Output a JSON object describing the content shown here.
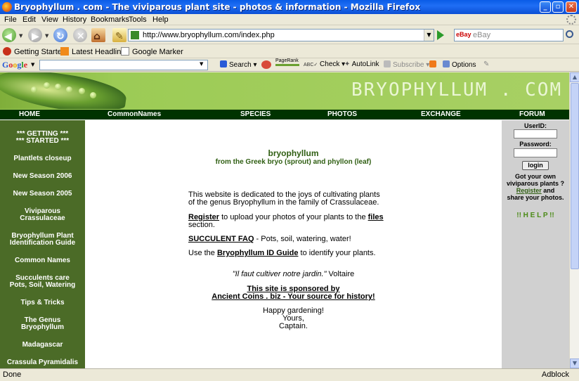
{
  "window": {
    "title": "Bryophyllum . com - The viviparous plant site - photos & information - Mozilla Firefox"
  },
  "menu": [
    "File",
    "Edit",
    "View",
    "History",
    "Bookmarks",
    "Tools",
    "Help"
  ],
  "navbar": {
    "url": "http://www.bryophyllum.com/index.php",
    "search_placeholder": "eBay",
    "search_engine_label": "eBay"
  },
  "bookmarks": [
    "Getting Started",
    "Latest Headlines",
    "Google Marker"
  ],
  "google_toolbar": {
    "logo": "Google",
    "items": {
      "search": "Search",
      "pagerank": "PageRank",
      "check": "Check",
      "autolink": "AutoLink",
      "subscribe": "Subscribe",
      "options": "Options"
    }
  },
  "site": {
    "brand": "BRYOPHYLLUM . COM",
    "topnav": [
      "HOME",
      "CommonNames",
      "SPECIES",
      "PHOTOS",
      "EXCHANGE",
      "FORUM"
    ],
    "leftnav": [
      [
        "*** GETTING ***",
        "*** STARTED ***"
      ],
      [
        "Plantlets closeup"
      ],
      [
        "New Season 2006"
      ],
      [
        "New Season 2005"
      ],
      [
        "Viviparous",
        "Crassulaceae"
      ],
      [
        "Bryophyllum Plant",
        "Identification Guide"
      ],
      [
        "Common Names"
      ],
      [
        "Succulents care",
        "Pots, Soil, Watering"
      ],
      [
        "Tips & Tricks"
      ],
      [
        "The Genus",
        "Bryophyllum"
      ],
      [
        "Madagascar"
      ],
      [
        "Crassula Pyramidalis"
      ]
    ],
    "main": {
      "heading": "bryophyllum",
      "subheading": "from the Greek bryo (sprout) and phyllon (leaf)",
      "intro_line1": "This website is dedicated to the joys of cultivating plants",
      "intro_line2": "of the genus Bryophyllum in the family of Crassulaceae.",
      "register_link": "Register",
      "register_text": " to upload your photos of your plants to the ",
      "files_link": "files",
      "register_end": "section.",
      "faq_link": "SUCCULENT FAQ",
      "faq_text": " - Pots, soil, watering, water!",
      "guide_pre": "Use the ",
      "guide_link": "Bryophyllum ID Guide",
      "guide_post": " to identify your plants.",
      "quote": "\"Il faut cultiver notre jardin.\"",
      "quote_author": " Voltaire",
      "sponsor_line1": "This site is sponsored by",
      "sponsor_line2": "Ancient Coins . biz - Your source for history!",
      "sign1": "Happy gardening!",
      "sign2": "Yours,",
      "sign3": "Captain."
    },
    "login": {
      "userid_label": "UserID:",
      "password_label": "Password:",
      "login_button": "login",
      "own_plants1": "Got your own",
      "own_plants2": "viviparous plants ?",
      "register_link": "Register",
      "register_and": " and",
      "share": "share your photos.",
      "help": "!! H E L P !!"
    }
  },
  "status": {
    "text": "Done",
    "addon": "Adblock"
  }
}
